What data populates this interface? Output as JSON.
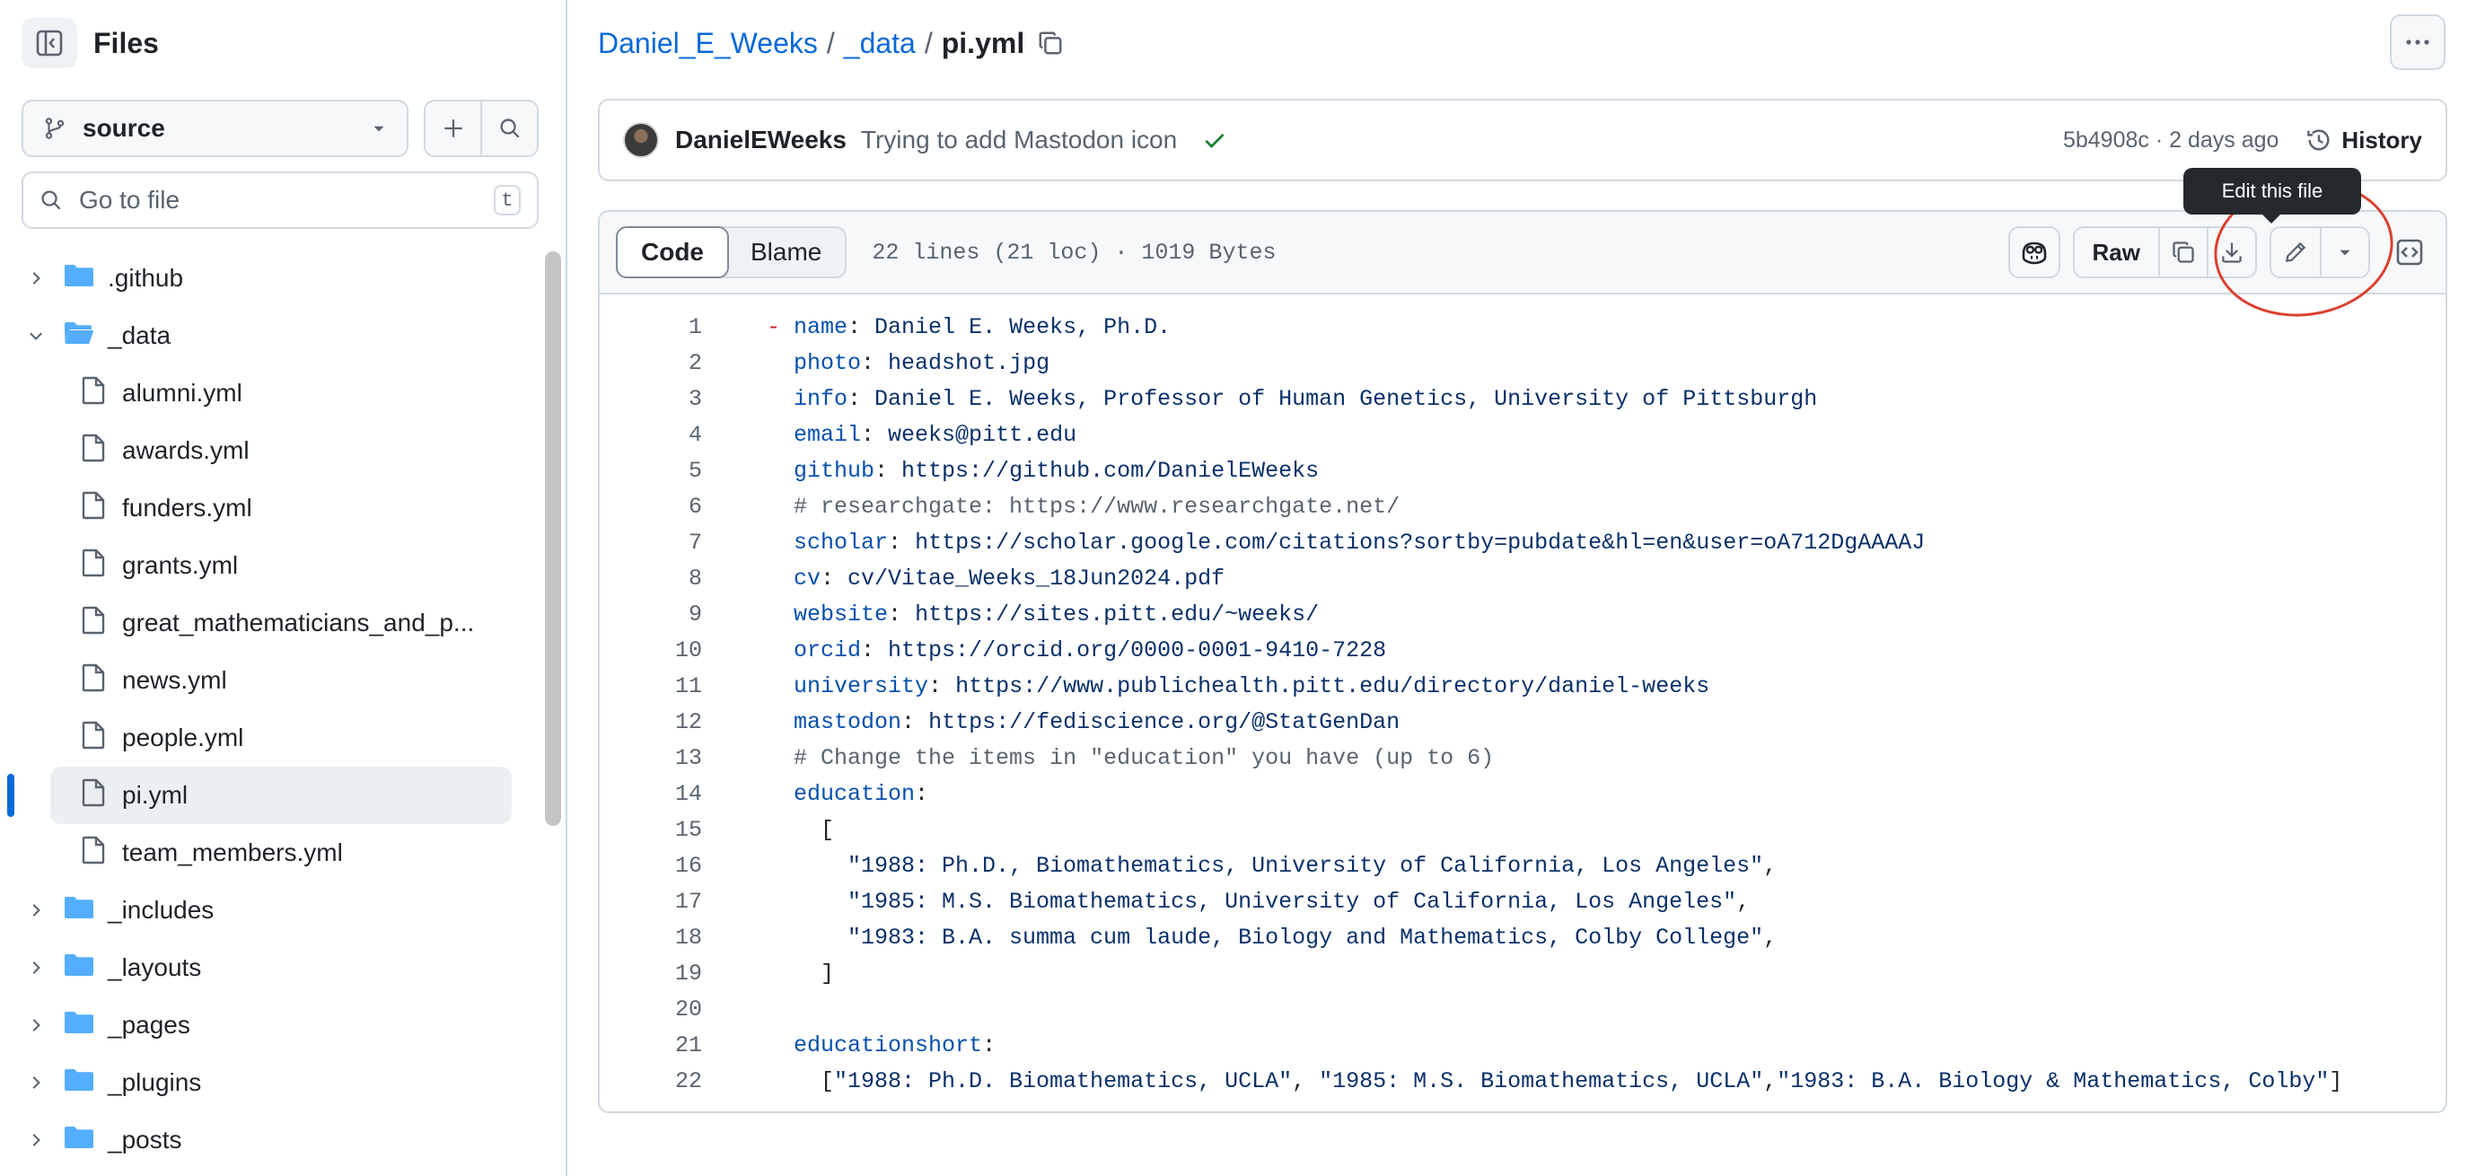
{
  "sidebar": {
    "title": "Files",
    "branch": "source",
    "goto_placeholder": "Go to file",
    "goto_shortcut": "t",
    "items": [
      {
        "type": "folder",
        "name": ".github",
        "expanded": false
      },
      {
        "type": "folder",
        "name": "_data",
        "expanded": true
      },
      {
        "type": "file",
        "name": "alumni.yml"
      },
      {
        "type": "file",
        "name": "awards.yml"
      },
      {
        "type": "file",
        "name": "funders.yml"
      },
      {
        "type": "file",
        "name": "grants.yml"
      },
      {
        "type": "file",
        "name": "great_mathematicians_and_p..."
      },
      {
        "type": "file",
        "name": "news.yml"
      },
      {
        "type": "file",
        "name": "people.yml"
      },
      {
        "type": "file",
        "name": "pi.yml",
        "selected": true
      },
      {
        "type": "file",
        "name": "team_members.yml"
      },
      {
        "type": "folder",
        "name": "_includes",
        "expanded": false
      },
      {
        "type": "folder",
        "name": "_layouts",
        "expanded": false
      },
      {
        "type": "folder",
        "name": "_pages",
        "expanded": false
      },
      {
        "type": "folder",
        "name": "_plugins",
        "expanded": false
      },
      {
        "type": "folder",
        "name": "_posts",
        "expanded": false
      }
    ]
  },
  "breadcrumb": {
    "repo": "Daniel_E_Weeks",
    "sep": "/",
    "folder": "_data",
    "file": "pi.yml"
  },
  "commit": {
    "author": "DanielEWeeks",
    "message": "Trying to add Mastodon icon",
    "meta": "5b4908c · 2 days ago",
    "history_label": "History"
  },
  "toolbar": {
    "code_label": "Code",
    "blame_label": "Blame",
    "meta": "22 lines (21 loc) · 1019 Bytes",
    "raw_label": "Raw",
    "tooltip": "Edit this file"
  },
  "colors": {
    "accent": "#0969da",
    "success": "#1a7f37",
    "annotation": "#d9412f"
  },
  "code_lines": [
    [
      [
        "d",
        "- "
      ],
      [
        "k",
        "name"
      ],
      [
        "p",
        ": "
      ],
      [
        "v",
        "Daniel E. Weeks, Ph.D."
      ]
    ],
    [
      [
        "v",
        "  "
      ],
      [
        "k",
        "photo"
      ],
      [
        "p",
        ": "
      ],
      [
        "v",
        "headshot.jpg"
      ]
    ],
    [
      [
        "v",
        "  "
      ],
      [
        "k",
        "info"
      ],
      [
        "p",
        ": "
      ],
      [
        "v",
        "Daniel E. Weeks, Professor of Human Genetics, University of Pittsburgh"
      ]
    ],
    [
      [
        "v",
        "  "
      ],
      [
        "k",
        "email"
      ],
      [
        "p",
        ": "
      ],
      [
        "v",
        "weeks@pitt.edu"
      ]
    ],
    [
      [
        "v",
        "  "
      ],
      [
        "k",
        "github"
      ],
      [
        "p",
        ": "
      ],
      [
        "v",
        "https://github.com/DanielEWeeks"
      ]
    ],
    [
      [
        "v",
        "  "
      ],
      [
        "cm",
        "# researchgate: https://www.researchgate.net/"
      ]
    ],
    [
      [
        "v",
        "  "
      ],
      [
        "k",
        "scholar"
      ],
      [
        "p",
        ": "
      ],
      [
        "v",
        "https://scholar.google.com/citations?sortby=pubdate&hl=en&user=oA712DgAAAAJ"
      ]
    ],
    [
      [
        "v",
        "  "
      ],
      [
        "k",
        "cv"
      ],
      [
        "p",
        ": "
      ],
      [
        "v",
        "cv/Vitae_Weeks_18Jun2024.pdf"
      ]
    ],
    [
      [
        "v",
        "  "
      ],
      [
        "k",
        "website"
      ],
      [
        "p",
        ": "
      ],
      [
        "v",
        "https://sites.pitt.edu/~weeks/"
      ]
    ],
    [
      [
        "v",
        "  "
      ],
      [
        "k",
        "orcid"
      ],
      [
        "p",
        ": "
      ],
      [
        "v",
        "https://orcid.org/0000-0001-9410-7228"
      ]
    ],
    [
      [
        "v",
        "  "
      ],
      [
        "k",
        "university"
      ],
      [
        "p",
        ": "
      ],
      [
        "v",
        "https://www.publichealth.pitt.edu/directory/daniel-weeks"
      ]
    ],
    [
      [
        "v",
        "  "
      ],
      [
        "k",
        "mastodon"
      ],
      [
        "p",
        ": "
      ],
      [
        "v",
        "https://fediscience.org/@StatGenDan"
      ]
    ],
    [
      [
        "v",
        "  "
      ],
      [
        "cm",
        "# Change the items in \"education\" you have (up to 6)"
      ]
    ],
    [
      [
        "v",
        "  "
      ],
      [
        "k",
        "education"
      ],
      [
        "p",
        ":"
      ]
    ],
    [
      [
        "p",
        "    ["
      ]
    ],
    [
      [
        "v",
        "      \"1988: Ph.D., Biomathematics, University of California, Los Angeles\""
      ],
      [
        "p",
        ","
      ]
    ],
    [
      [
        "v",
        "      \"1985: M.S. Biomathematics, University of California, Los Angeles\""
      ],
      [
        "p",
        ","
      ]
    ],
    [
      [
        "v",
        "      \"1983: B.A. summa cum laude, Biology and Mathematics, Colby College\""
      ],
      [
        "p",
        ","
      ]
    ],
    [
      [
        "p",
        "    ]"
      ]
    ],
    [],
    [
      [
        "v",
        "  "
      ],
      [
        "k",
        "educationshort"
      ],
      [
        "p",
        ":"
      ]
    ],
    [
      [
        "p",
        "    ["
      ],
      [
        "v",
        "\"1988: Ph.D. Biomathematics, UCLA\""
      ],
      [
        "p",
        ", "
      ],
      [
        "v",
        "\"1985: M.S. Biomathematics, UCLA\""
      ],
      [
        "p",
        ","
      ],
      [
        "v",
        "\"1983: B.A. Biology & Mathematics, Colby\""
      ],
      [
        "p",
        "]"
      ]
    ]
  ]
}
